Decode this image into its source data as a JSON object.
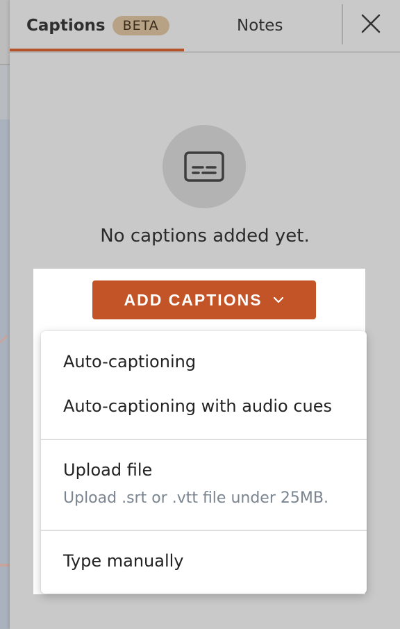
{
  "tabs": {
    "captions_label": "Captions",
    "beta_badge": "BETA",
    "notes_label": "Notes"
  },
  "empty_state": {
    "icon": "captions-icon",
    "message": "No captions added yet."
  },
  "add_button": {
    "label": "ADD CAPTIONS",
    "icon": "chevron-down-icon"
  },
  "menu": {
    "items": [
      {
        "label": "Auto-captioning"
      },
      {
        "label": "Auto-captioning with audio cues"
      },
      {
        "label": "Upload file",
        "sublabel": "Upload .srt or .vtt file under 25MB."
      },
      {
        "label": "Type manually"
      }
    ]
  },
  "colors": {
    "accent": "#c25427",
    "badge_bg": "#b8a286",
    "overlay": "#c9c9c9"
  }
}
